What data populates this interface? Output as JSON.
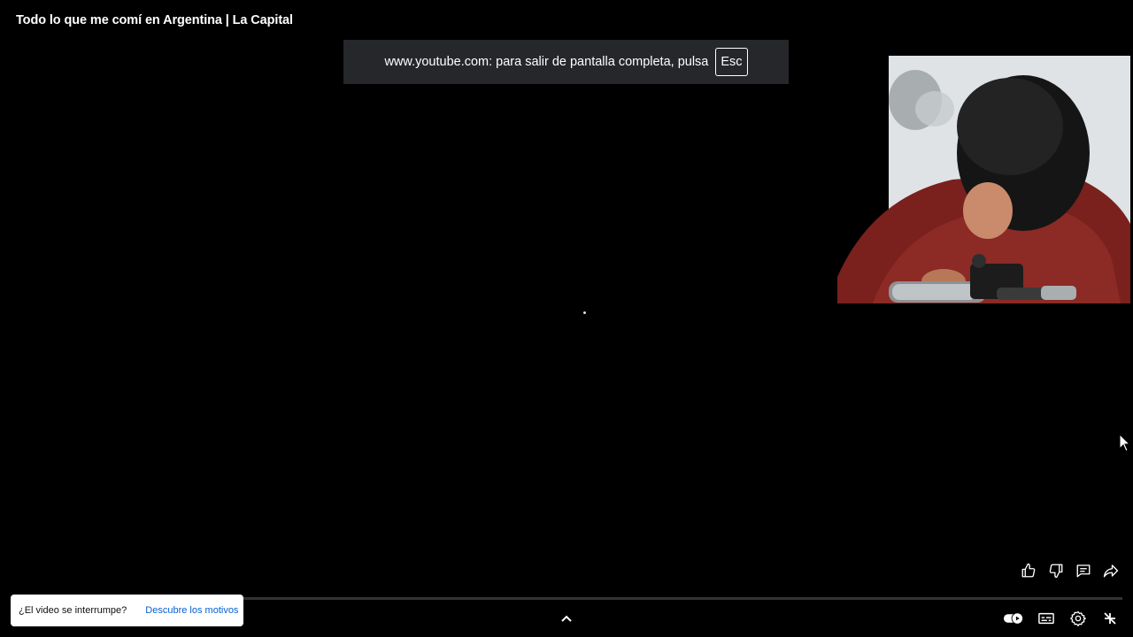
{
  "video": {
    "title": "Todo lo que me comí en Argentina | La Capital"
  },
  "fullscreen_notice": {
    "message": "www.youtube.com: para salir de pantalla completa, pulsa",
    "key_label": "Esc"
  },
  "actions": [
    {
      "icon": "thumbs-up-icon"
    },
    {
      "icon": "thumbs-down-icon"
    },
    {
      "icon": "comments-icon"
    },
    {
      "icon": "share-icon"
    }
  ],
  "buffer_notice": {
    "question": "¿El video se interrumpe?",
    "link_label": "Descubre los motivos",
    "link_color": "#065fd4"
  },
  "controls": [
    {
      "icon": "autoplay-toggle-icon"
    },
    {
      "icon": "subtitles-icon"
    },
    {
      "icon": "settings-icon"
    },
    {
      "icon": "exit-fullscreen-icon"
    }
  ],
  "colors": {
    "background": "#000000",
    "notice_bg": "#25272b",
    "progress_track": "#ffffff33"
  }
}
